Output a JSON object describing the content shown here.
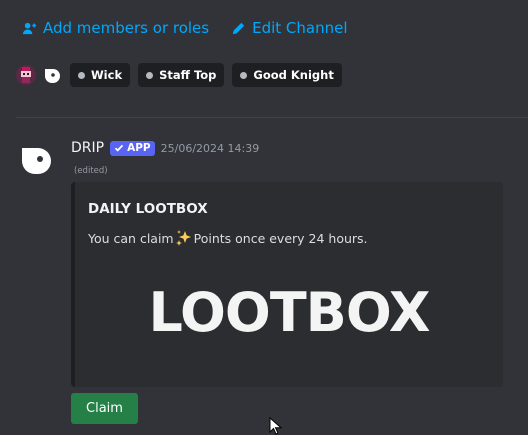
{
  "header": {
    "add_members_label": "Add members or roles",
    "edit_channel_label": "Edit Channel",
    "link_color": "#00a8fc"
  },
  "members": {
    "chips": [
      {
        "label": "Wick"
      },
      {
        "label": "Staff Top"
      },
      {
        "label": "Good Knight"
      }
    ]
  },
  "message": {
    "author": "DRIP",
    "badge": "APP",
    "timestamp": "25/06/2024 14:39",
    "edited": "(edited)",
    "embed": {
      "title": "DAILY LOOTBOX",
      "desc_before": "You can claim",
      "desc_after": "Points once every 24 hours.",
      "image_text": "LOOTBOX"
    },
    "button_label": "Claim",
    "button_color": "#248046"
  },
  "colors": {
    "background": "#313338",
    "embed_bg": "#2b2d31",
    "badge": "#5865f2"
  }
}
